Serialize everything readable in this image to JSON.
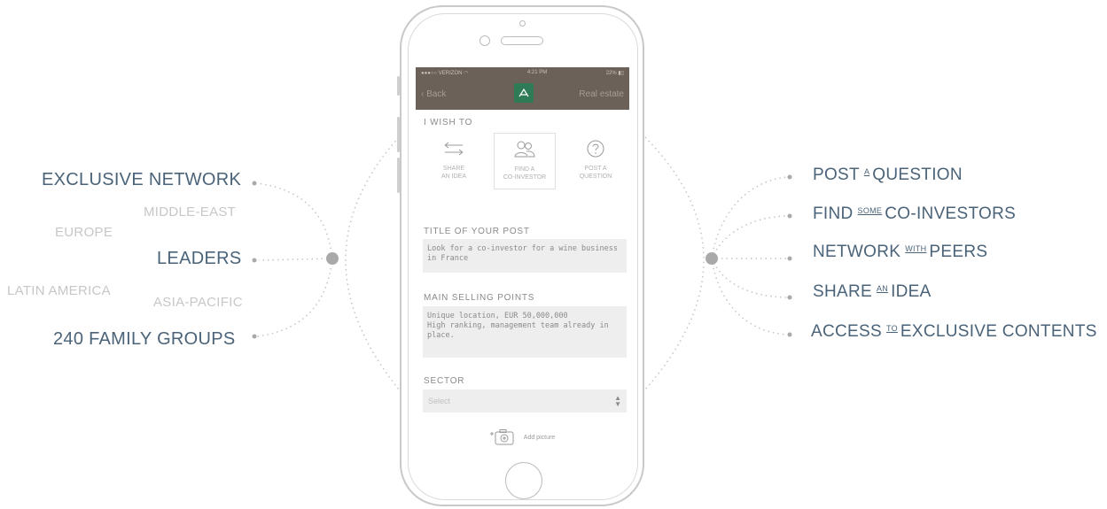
{
  "left_labels": {
    "exclusive_network": "EXCLUSIVE NETWORK",
    "leaders": "LEADERS",
    "family_groups": "240 FAMILY GROUPS",
    "regions": {
      "middle_east": "MIDDLE-EAST",
      "europe": "EUROPE",
      "latin_america": "LATIN AMERICA",
      "asia_pacific": "ASIA-PACIFIC"
    }
  },
  "right_features": [
    {
      "main1": "POST",
      "small": "A",
      "main2": "QUESTION"
    },
    {
      "main1": "FIND",
      "small": "SOME",
      "main2": "CO-INVESTORS"
    },
    {
      "main1": "NETWORK",
      "small": "WITH",
      "main2": "PEERS"
    },
    {
      "main1": "SHARE",
      "small": "AN",
      "main2": "IDEA"
    },
    {
      "main1": "ACCESS",
      "small": "TO",
      "main2": "EXCLUSIVE CONTENTS"
    }
  ],
  "phone": {
    "status": {
      "carrier": "●●●○○ VERIZON ◠",
      "time": "4:21 PM",
      "battery": "22% ▮▯"
    },
    "nav": {
      "back": "‹ Back",
      "right": "Real estate"
    },
    "wish_title": "I WISH TO",
    "wish_options": [
      {
        "line1": "SHARE",
        "line2": "AN IDEA"
      },
      {
        "line1": "FIND A",
        "line2": "CO-INVESTOR"
      },
      {
        "line1": "POST A",
        "line2": "QUESTION"
      }
    ],
    "title_label": "TITLE OF YOUR POST",
    "title_value": "Look for a co-investor for a wine business in France",
    "selling_label": "MAIN SELLING POINTS",
    "selling_value_line1": "Unique location, EUR 50,000,000",
    "selling_value_line2": "High ranking, management team already in place.",
    "sector_label": "SECTOR",
    "sector_placeholder": "Select",
    "add_picture": "Add picture"
  },
  "colors": {
    "label_blue": "#4a6379",
    "region_grey": "#c7c7c7",
    "nav_brown": "#6b6159",
    "logo_green": "#2f7b57",
    "node_grey": "#a9a9a9"
  }
}
